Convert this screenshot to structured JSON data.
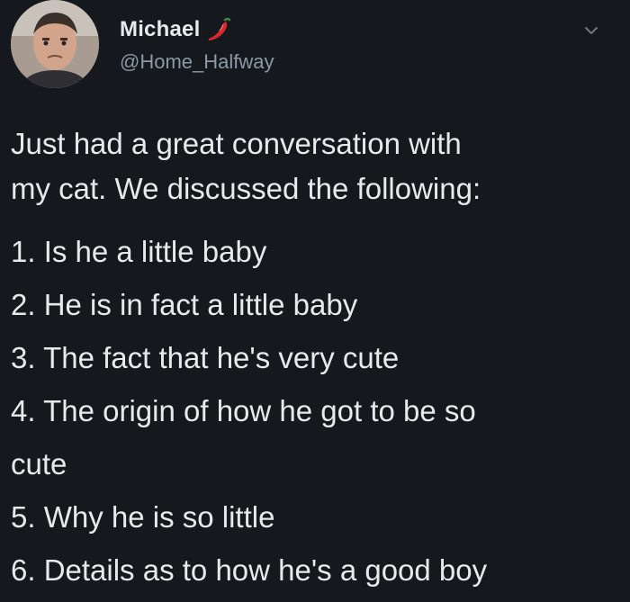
{
  "user": {
    "display_name": "Michael",
    "handle": "@Home_Halfway",
    "badge_icon": "chili-pepper-icon"
  },
  "menu": {
    "icon": "chevron-down-icon"
  },
  "tweet": {
    "intro_line_1": "Just had a great conversation with",
    "intro_line_2": "my cat. We discussed the following:",
    "items": [
      "1. Is he a little baby",
      "2. He is in fact a little baby",
      "3. The fact that he's very cute",
      "4. The origin of how he got to be so",
      "cute",
      "5. Why he is so little",
      "6. Details as to how he's a good boy"
    ]
  },
  "colors": {
    "background": "#15181d",
    "text": "#e7e9ea",
    "secondary_text": "#8b98a5",
    "pepper": "#d6282f"
  }
}
